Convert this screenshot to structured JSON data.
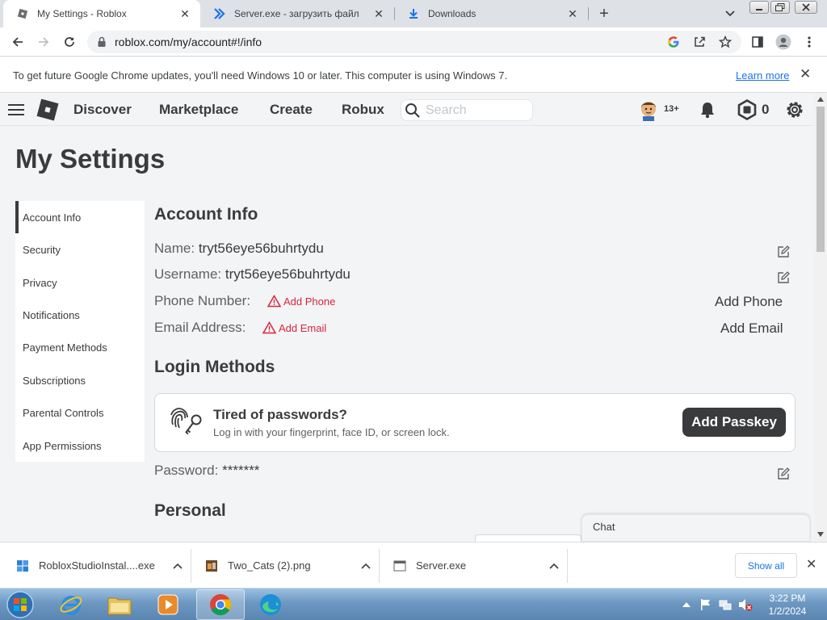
{
  "browser": {
    "tabs": [
      {
        "title": "My Settings - Roblox",
        "active": true
      },
      {
        "title": "Server.exe - загрузить файл",
        "active": false
      },
      {
        "title": "Downloads",
        "active": false
      }
    ],
    "new_tab_symbol": "+",
    "close_symbol": "✕",
    "url": "roblox.com/my/account#!/info"
  },
  "infobar": {
    "message": "To get future Google Chrome updates, you'll need Windows 10 or later. This computer is using Windows 7.",
    "learn_more": "Learn more"
  },
  "roblox_header": {
    "nav": [
      "Discover",
      "Marketplace",
      "Create",
      "Robux"
    ],
    "search_placeholder": "Search",
    "age_badge": "13+",
    "robux_count": "0"
  },
  "page": {
    "title": "My Settings",
    "sidebar": [
      {
        "label": "Account Info",
        "active": true
      },
      {
        "label": "Security"
      },
      {
        "label": "Privacy"
      },
      {
        "label": "Notifications"
      },
      {
        "label": "Payment Methods"
      },
      {
        "label": "Subscriptions"
      },
      {
        "label": "Parental Controls"
      },
      {
        "label": "App Permissions"
      }
    ],
    "account_info": {
      "heading": "Account Info",
      "name_label": "Name:",
      "name_value": "tryt56eye56buhrtydu",
      "username_label": "Username:",
      "username_value": "tryt56eye56buhrtydu",
      "phone_label": "Phone Number:",
      "phone_warning": "Add Phone",
      "phone_action": "Add Phone",
      "email_label": "Email Address:",
      "email_warning": "Add Email",
      "email_action": "Add Email"
    },
    "login_methods": {
      "heading": "Login Methods",
      "passkey_title": "Tired of passwords?",
      "passkey_subtitle": "Log in with your fingerprint, face ID, or screen lock.",
      "passkey_button": "Add Passkey",
      "password_label": "Password:",
      "password_value": "*******"
    },
    "personal_heading": "Personal",
    "chat_label": "Chat"
  },
  "downloads": {
    "items": [
      {
        "name": "RobloxStudioInstal....exe"
      },
      {
        "name": "Two_Cats (2).png"
      },
      {
        "name": "Server.exe"
      }
    ],
    "show_all": "Show all"
  },
  "taskbar": {
    "time": "3:22 PM",
    "date": "1/2/2024"
  },
  "colors": {
    "roblox_bg": "#f2f4f5",
    "warning_red": "#d7263d",
    "chrome_link": "#1a73e8",
    "button_dark": "#393b3d"
  }
}
